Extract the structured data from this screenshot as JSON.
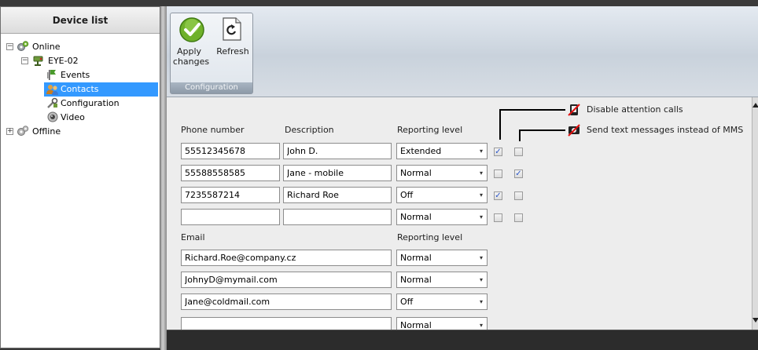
{
  "device_list": {
    "title": "Device list",
    "tree": [
      {
        "label": "Online",
        "expander": "−"
      },
      {
        "label": "EYE-02",
        "expander": "−"
      },
      {
        "label": "Events"
      },
      {
        "label": "Contacts",
        "selected": true
      },
      {
        "label": "Configuration"
      },
      {
        "label": "Video"
      },
      {
        "label": "Offline",
        "expander": "+"
      }
    ]
  },
  "ribbon": {
    "apply_label_1": "Apply",
    "apply_label_2": "changes",
    "refresh_label": "Refresh",
    "group_label": "Configuration"
  },
  "legend": {
    "disable_calls": "Disable attention calls",
    "send_text": "Send text messages instead of MMS"
  },
  "phones": {
    "col_phone": "Phone number",
    "col_description": "Description",
    "col_reporting": "Reporting level",
    "rows": [
      {
        "phone": "55512345678",
        "description": "John D.",
        "level": "Extended",
        "disable": true,
        "text": false
      },
      {
        "phone": "55588558585",
        "description": "Jane - mobile",
        "level": "Normal",
        "disable": false,
        "text": true
      },
      {
        "phone": "7235587214",
        "description": "Richard Roe",
        "level": "Off",
        "disable": true,
        "text": false
      },
      {
        "phone": "",
        "description": "",
        "level": "Normal",
        "disable": false,
        "text": false
      }
    ]
  },
  "emails": {
    "col_email": "Email",
    "col_reporting": "Reporting level",
    "rows": [
      {
        "email": "Richard.Roe@company.cz",
        "level": "Normal"
      },
      {
        "email": "JohnyD@mymail.com",
        "level": "Normal"
      },
      {
        "email": "Jane@coldmail.com",
        "level": "Off"
      },
      {
        "email": "",
        "level": "Normal"
      }
    ]
  },
  "glyphs": {
    "dropdown": "▾",
    "check": "✓"
  },
  "colors": {
    "selection": "#3399ff",
    "apply_green": "#6fb12a"
  }
}
